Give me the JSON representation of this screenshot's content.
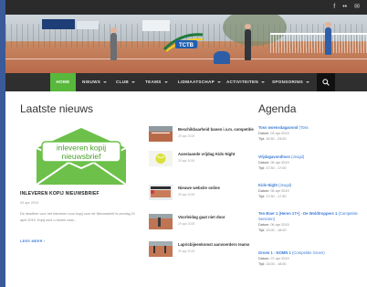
{
  "topbar": {
    "social": [
      {
        "icon": "facebook-icon",
        "glyph": "f"
      },
      {
        "icon": "flickr-icon",
        "glyph": "••"
      },
      {
        "icon": "email-icon",
        "glyph": "✉"
      }
    ]
  },
  "hero": {
    "logo_text": "TCTB"
  },
  "nav": {
    "items": [
      {
        "label": "HOME",
        "active": true
      },
      {
        "label": "NIEUWS",
        "caret": true
      },
      {
        "label": "CLUB",
        "caret": true
      },
      {
        "label": "TEAMS",
        "caret": true
      },
      {
        "label": "LIDMAATSCHAP",
        "caret": true
      },
      {
        "label": "ACTIVITEITEN",
        "caret": true
      },
      {
        "label": "SPONSORING",
        "caret": true
      }
    ],
    "accent": "#57b83c"
  },
  "news": {
    "title": "Laatste nieuws",
    "feature": {
      "image_line1": "inleveren kopij",
      "image_line2": "nieuwsbrief",
      "heading": "INLEVEREN KOPIJ NIEUWSBRIEF",
      "date": "29 apr 2019",
      "excerpt": "De deadline voor het inleveren voor kopij voor de Nieuwsbrief is zondag 21 april 2019. Kopij kunt u sturen naar...",
      "read_more": "LEES MEER ›"
    },
    "list": [
      {
        "title": "Beschikbaarheid banen i.v.m. competitie",
        "date": "29 apr 2019"
      },
      {
        "title": "Aanstaande vrijdag Kids Night",
        "date": "29 apr 2019"
      },
      {
        "title": "Nieuwe website online",
        "date": "29 apr 2019"
      },
      {
        "title": "Voorleidag gaat niet door",
        "date": "29 apr 2019"
      },
      {
        "title": "Lapricbijeenkomst aanvoerders teams",
        "date": "29 apr 2019"
      }
    ]
  },
  "agenda": {
    "title": "Agenda",
    "items": [
      {
        "title": "Toss woensdagavond",
        "sub": "(Toss",
        "date_label": "Datum:",
        "date": "03 apr 2019",
        "time_label": "Tijd:",
        "time": "19:30 - 23:00"
      },
      {
        "title": "Vrijdagavondtoss",
        "sub": "(Jeugd)",
        "date_label": "Datum:",
        "date": "05 apr 2019",
        "time_label": "Tijd:",
        "time": "17:30 - 17:00"
      },
      {
        "title": "Kids Night",
        "sub": "(Jeugd)",
        "date_label": "Datum:",
        "date": "05 apr 2019",
        "time_label": "Tijd:",
        "time": "17:30 - 17:30"
      },
      {
        "title": "Ten Boer 1 (Heren 17+) - De Woldtroppers 1",
        "sub": "(Competitie Senioren)",
        "date_label": "Datum:",
        "date": "06 apr 2019",
        "time_label": "Tijd:",
        "time": "13:00 - 18:00"
      },
      {
        "title": "Groen 1 - NOMN 1",
        "sub": "(Competitie Groen)",
        "date_label": "Datum:",
        "date": "07 apr 2019",
        "time_label": "Tijd:",
        "time": "13:00 - 18:00"
      }
    ]
  },
  "colors": {
    "link": "#3b7bd4",
    "nav_bg": "#2f2f2f",
    "feature_green": "#6dc04a"
  }
}
